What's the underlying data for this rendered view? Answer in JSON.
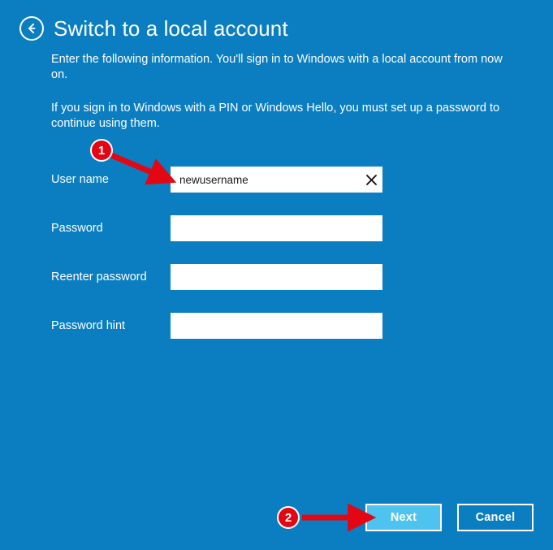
{
  "window": {
    "background_color": "#0a7ec0",
    "title": "Switch to a local account",
    "back_icon": "back-arrow-circle-icon"
  },
  "description": {
    "intro": "Enter the following information. You'll sign in to Windows with a local account from now on.",
    "pin_notice": "If you sign in to Windows with a PIN or Windows Hello, you must set up a password to continue using them."
  },
  "form": {
    "fields": [
      {
        "label": "User name",
        "name": "user-name",
        "value": "newusername",
        "placeholder": "",
        "type": "text",
        "has_clear_button": true,
        "clear_icon": "close-x-icon"
      },
      {
        "label": "Password",
        "name": "password",
        "value": "",
        "placeholder": "",
        "type": "password",
        "has_clear_button": false,
        "clear_icon": ""
      },
      {
        "label": "Reenter password",
        "name": "reenter-password",
        "value": "",
        "placeholder": "",
        "type": "password",
        "has_clear_button": false,
        "clear_icon": ""
      },
      {
        "label": "Password hint",
        "name": "password-hint",
        "value": "",
        "placeholder": "",
        "type": "text",
        "has_clear_button": false,
        "clear_icon": ""
      }
    ]
  },
  "footer": {
    "next_label": "Next",
    "cancel_label": "Cancel",
    "next_state": "highlighted",
    "next_fill_color": "#4ec3f0"
  },
  "annotations": {
    "color": "#e30613",
    "markers": [
      {
        "number": "1",
        "target": "user-name-input",
        "arrow": "diagonal-down-right"
      },
      {
        "number": "2",
        "target": "next-button",
        "arrow": "horizontal-right"
      }
    ]
  }
}
